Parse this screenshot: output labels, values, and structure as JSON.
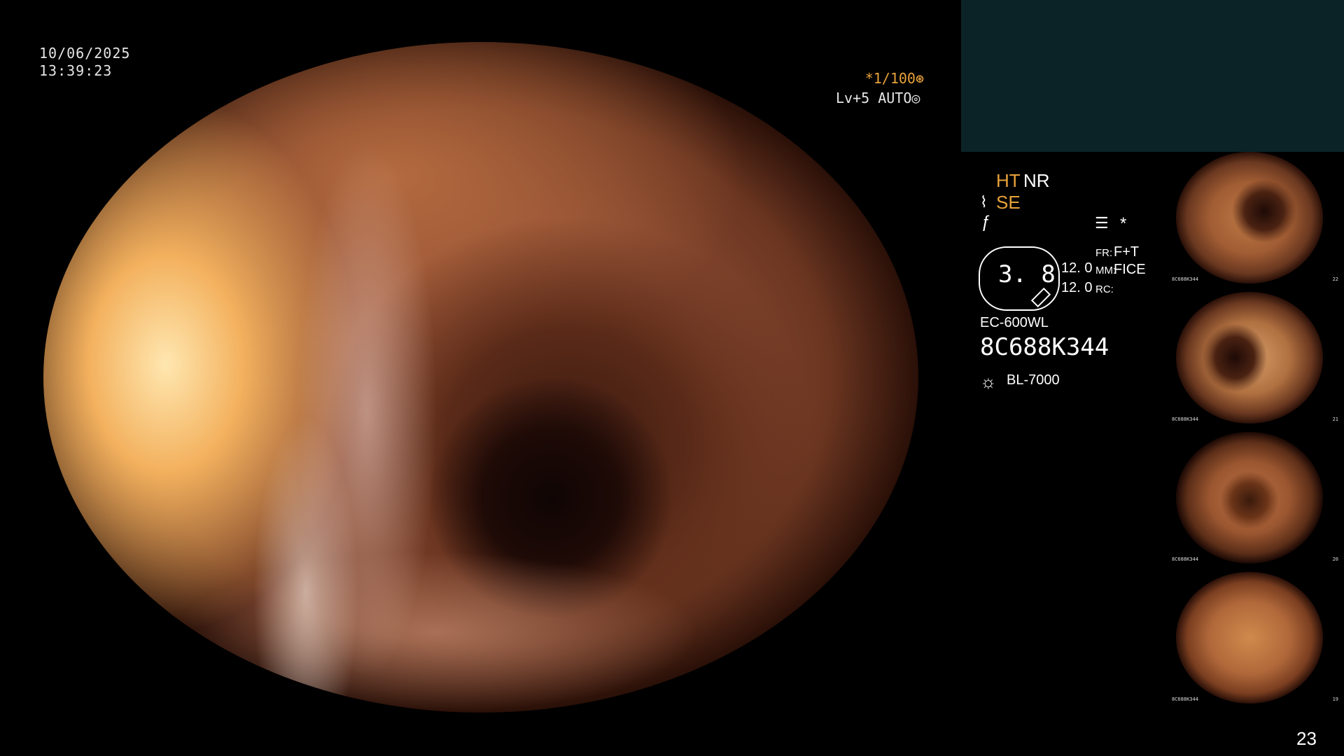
{
  "overlay": {
    "date": "10/06/2025",
    "time": "13:39:23",
    "shutter": "*1/100⊛",
    "level": "Lv+5 AUTO◎"
  },
  "panel": {
    "ht": "HT",
    "nr": "NR",
    "se": "SE",
    "se_icon": "scope-icon",
    "f_icon": "slash-f-icon",
    "menu_icon": "list-icon",
    "star": "*",
    "dial_value": "3. 8",
    "value_1": "12. 0",
    "value_2": "12. 0",
    "fr_label": "FR:",
    "fr_value": "F+T",
    "mm_label": "MM:",
    "mm_value": "FICE",
    "rc_label": "RC:",
    "model": "EC-600WL",
    "serial": "8C688K344",
    "light_icon": "sun-icon",
    "light_source": "BL-7000"
  },
  "thumbnails": [
    {
      "caption": "8C688K344",
      "number": "22"
    },
    {
      "caption": "8C688K344",
      "number": "21"
    },
    {
      "caption": "8C688K344",
      "number": "20"
    },
    {
      "caption": "8C688K344",
      "number": "19"
    }
  ],
  "page_number": "23",
  "colors": {
    "accent": "#e8a23a",
    "panel_top": "#0b2326",
    "background": "#000000"
  }
}
